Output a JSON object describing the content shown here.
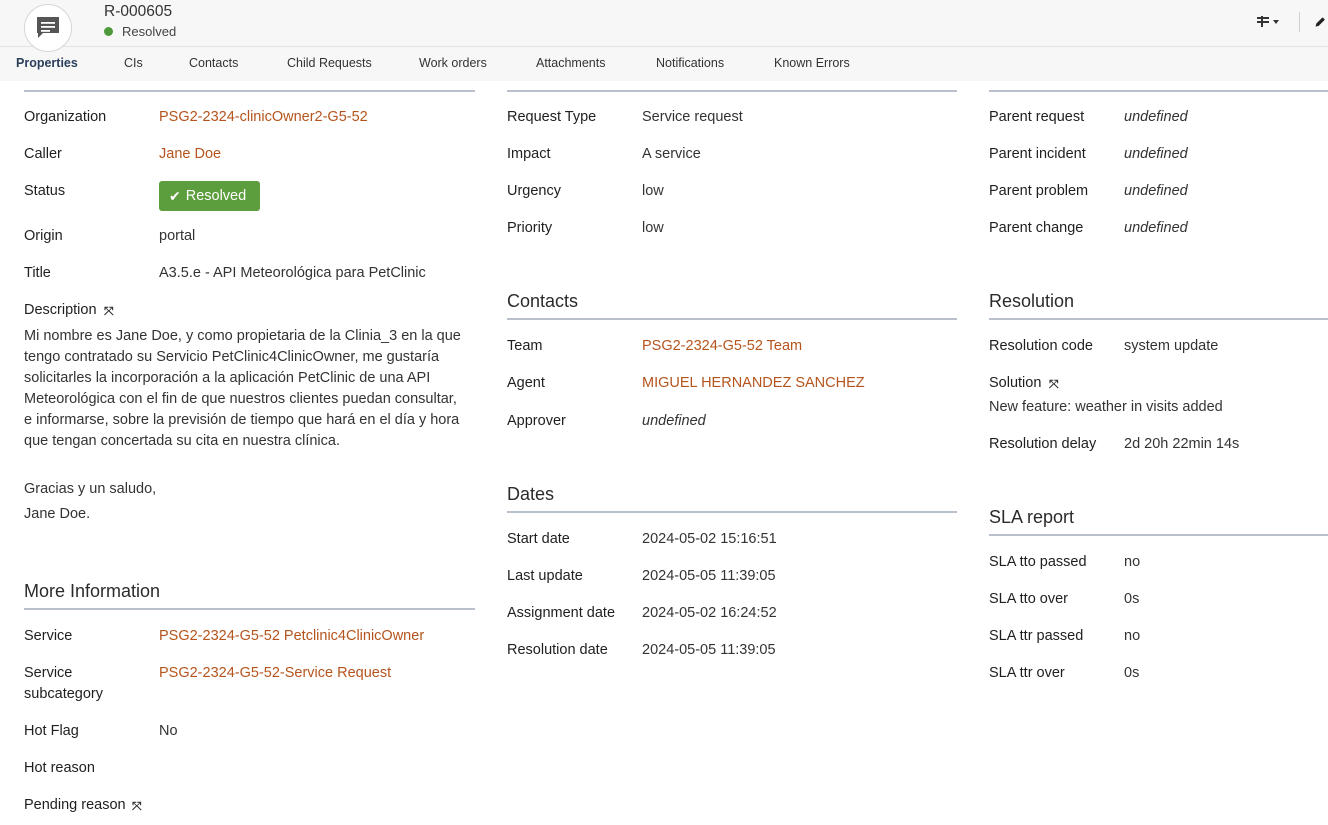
{
  "header": {
    "ticket_id": "R-000605",
    "status": "Resolved",
    "status_color": "#4e9a3a",
    "avatar_icon": "comment-icon",
    "actions_icon": "actions-menu-icon",
    "edit_icon": "pencil-icon"
  },
  "tabs": [
    "Properties",
    "CIs",
    "Contacts",
    "Child Requests",
    "Work orders",
    "Attachments",
    "Notifications",
    "Known Errors"
  ],
  "active_tab": "Properties",
  "left": {
    "organization_label": "Organization",
    "organization": "PSG2-2324-clinicOwner2-G5-52",
    "caller_label": "Caller",
    "caller": "Jane Doe",
    "status_label": "Status",
    "status_badge": "Resolved",
    "origin_label": "Origin",
    "origin": "portal",
    "title_label": "Title",
    "title": "A3.5.e - API Meteorológica para PetClinic",
    "description_label": "Description",
    "description_lines": [
      "Mi nombre es Jane Doe, y como propietaria de la Clinia_3 en la que",
      "tengo contratado su Servicio PetClinic4ClinicOwner, me gustaría",
      "solicitarles la incorporación a la aplicación PetClinic de una API",
      "Meteorológica con el fin de que nuestros clientes puedan consultar,",
      "e informarse, sobre la previsión de tiempo que hará en el día y hora",
      "que tengan concertada su cita en nuestra clínica."
    ],
    "description_closing": "Gracias y un saludo,",
    "description_signature": "Jane Doe."
  },
  "more_info": {
    "title": "More Information",
    "service_label": "Service",
    "service": "PSG2-2324-G5-52 Petclinic4ClinicOwner",
    "subcategory_label_1": "Service",
    "subcategory_label_2": "subcategory",
    "subcategory": "PSG2-2324-G5-52-Service Request",
    "hot_flag_label": "Hot Flag",
    "hot_flag": "No",
    "hot_reason_label": "Hot reason",
    "pending_reason_label": "Pending reason"
  },
  "middle": {
    "request_type_label": "Request Type",
    "request_type": "Service request",
    "impact_label": "Impact",
    "impact": "A service",
    "urgency_label": "Urgency",
    "urgency": "low",
    "priority_label": "Priority",
    "priority": "low"
  },
  "contacts": {
    "title": "Contacts",
    "team_label": "Team",
    "team": "PSG2-2324-G5-52 Team",
    "agent_label": "Agent",
    "agent": "MIGUEL HERNANDEZ SANCHEZ",
    "approver_label": "Approver",
    "approver": "undefined"
  },
  "dates": {
    "title": "Dates",
    "start_label": "Start date",
    "start": "2024-05-02 15:16:51",
    "last_update_label": "Last update",
    "last_update": "2024-05-05 11:39:05",
    "assignment_label": "Assignment date",
    "assignment": "2024-05-02 16:24:52",
    "resolution_label": "Resolution date",
    "resolution": "2024-05-05 11:39:05"
  },
  "parents": {
    "request_label": "Parent request",
    "request": "undefined",
    "incident_label": "Parent incident",
    "incident": "undefined",
    "problem_label": "Parent problem",
    "problem": "undefined",
    "change_label": "Parent change",
    "change": "undefined"
  },
  "resolution": {
    "title": "Resolution",
    "code_label": "Resolution code",
    "code": "system update",
    "solution_label": "Solution",
    "solution": "New feature: weather in visits added",
    "delay_label": "Resolution delay",
    "delay": "2d 20h 22min 14s"
  },
  "sla": {
    "title": "SLA report",
    "tto_passed_label": "SLA tto passed",
    "tto_passed": "no",
    "tto_over_label": "SLA tto over",
    "tto_over": "0s",
    "ttr_passed_label": "SLA ttr passed",
    "ttr_passed": "no",
    "ttr_over_label": "SLA ttr over",
    "ttr_over": "0s"
  },
  "colors": {
    "link": "#b5541c",
    "badge": "#5c9e3d",
    "rule": "#b8c0cc",
    "active_tab": "#2b3e5c"
  }
}
